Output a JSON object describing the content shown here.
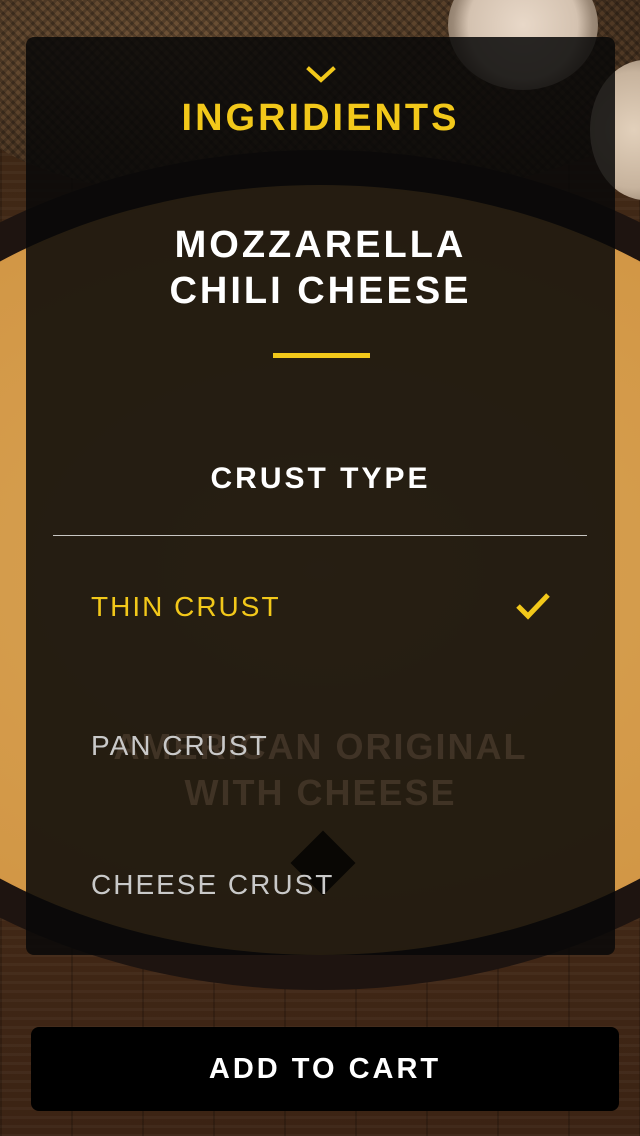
{
  "colors": {
    "accent": "#f2c81a",
    "panel": "#080808",
    "text_primary": "#ffffff",
    "text_muted": "#c9c9c9"
  },
  "header": {
    "collapse_icon": "chevron-down-icon",
    "section_title": "INGRIDIENTS"
  },
  "pizza": {
    "name_line1": "MOZZARELLA",
    "name_line2": "CHILI CHEESE"
  },
  "background_text": {
    "line1": "AMERICAN ORIGINAL",
    "line2": "WITH CHEESE"
  },
  "crust": {
    "heading": "CRUST TYPE",
    "selected_icon": "checkmark-icon",
    "options": [
      {
        "label": "THIN CRUST",
        "selected": true
      },
      {
        "label": "PAN CRUST",
        "selected": false
      },
      {
        "label": "CHEESE CRUST",
        "selected": false
      }
    ]
  },
  "cart": {
    "button_label": "ADD TO CART"
  }
}
